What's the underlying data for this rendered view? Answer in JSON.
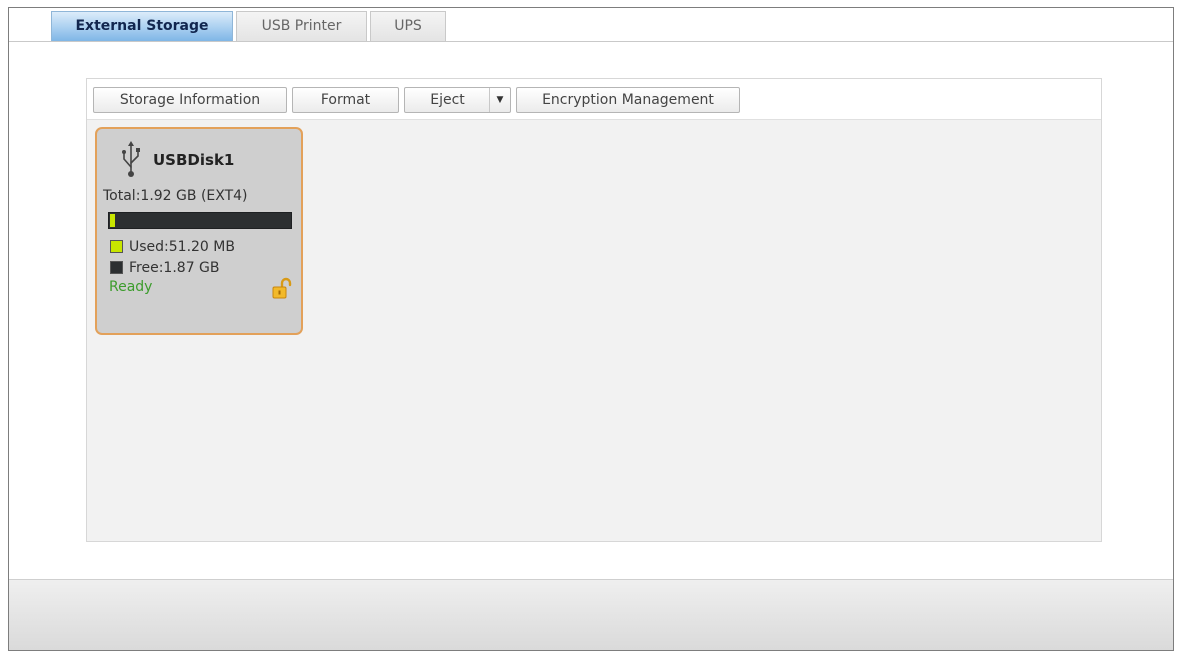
{
  "tabs": [
    {
      "label": "External Storage",
      "active": true
    },
    {
      "label": "USB Printer",
      "active": false
    },
    {
      "label": "UPS",
      "active": false
    }
  ],
  "toolbar": {
    "storage_info_label": "Storage Information",
    "format_label": "Format",
    "eject_label": "Eject",
    "encryption_label": "Encryption Management"
  },
  "disk": {
    "name": "USBDisk1",
    "total": "Total:1.92 GB (EXT4)",
    "used": "Used:51.20 MB",
    "free": "Free:1.87 GB",
    "status": "Ready",
    "used_fraction": 0.026,
    "icon": "usb-icon",
    "lock_icon": "unlocked-padlock-icon"
  },
  "colors": {
    "active_tab": "#a9cff0",
    "card_border": "#e3a15a",
    "used": "#c8e600",
    "free": "#2c2f31",
    "status": "#3c9c2c"
  }
}
